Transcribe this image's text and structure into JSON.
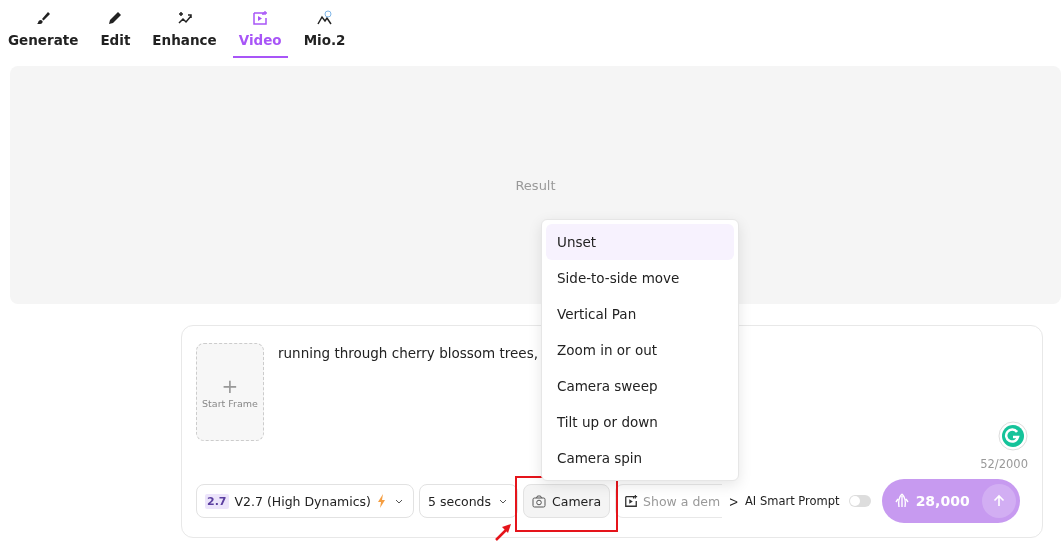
{
  "tabs": [
    {
      "label": "Generate",
      "selected": false
    },
    {
      "label": "Edit",
      "selected": false
    },
    {
      "label": "Enhance",
      "selected": false
    },
    {
      "label": "Video",
      "selected": true
    },
    {
      "label": "Mio.2",
      "selected": false
    }
  ],
  "result": {
    "label": "Result"
  },
  "composer": {
    "start_frame": {
      "plus": "+",
      "label": "Start Frame"
    },
    "prompt": "running through cherry blossom trees,",
    "counter": "52/2000",
    "model": {
      "badge": "2.7",
      "label": "V2.7 (High Dynamics)"
    },
    "duration": {
      "label": "5 seconds"
    },
    "camera": {
      "label": "Camera"
    },
    "demo": {
      "label": "Show a dem"
    },
    "more": ">",
    "smart_prompt": {
      "label": "AI Smart Prompt",
      "on": false
    },
    "generate": {
      "credits": "28,000"
    }
  },
  "camera_menu": [
    {
      "label": "Unset",
      "selected": true
    },
    {
      "label": "Side-to-side move",
      "selected": false
    },
    {
      "label": "Vertical Pan",
      "selected": false
    },
    {
      "label": "Zoom in or out",
      "selected": false
    },
    {
      "label": "Camera sweep",
      "selected": false
    },
    {
      "label": "Tilt up or down",
      "selected": false
    },
    {
      "label": "Camera spin",
      "selected": false
    }
  ]
}
